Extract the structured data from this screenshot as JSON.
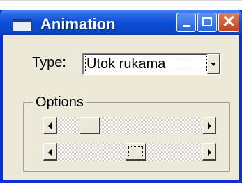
{
  "window": {
    "title": "Animation",
    "icon": "window-app-icon",
    "controls": {
      "minimize": "minimize-icon",
      "maximize": "maximize-icon",
      "close": "close-icon",
      "close_glyph": "✕"
    }
  },
  "type_field": {
    "label": "Type:",
    "value": "Utok rukama"
  },
  "options": {
    "legend": "Options",
    "sliders": [
      {
        "value_fraction": 0.18,
        "focused": false
      },
      {
        "value_fraction": 0.55,
        "focused": true
      }
    ]
  },
  "colors": {
    "titlebar": "#0a4ed6",
    "close_button": "#c4401c",
    "face": "#ece9d8"
  }
}
